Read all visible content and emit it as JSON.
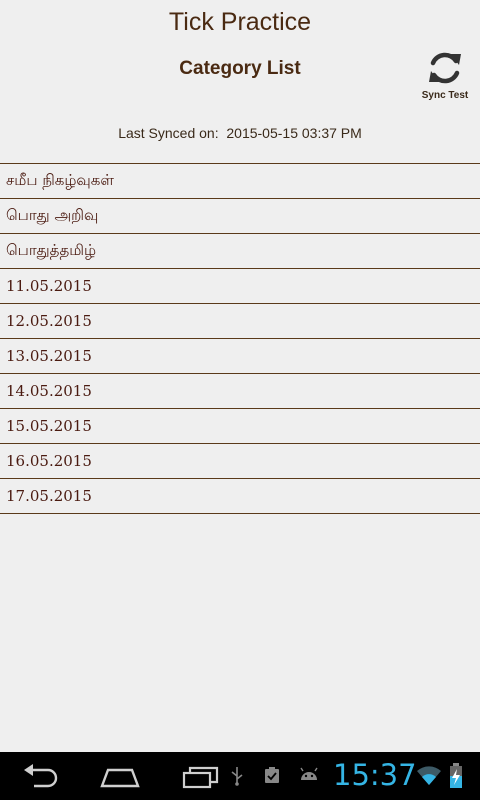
{
  "app": {
    "title": "Tick Practice"
  },
  "header": {
    "category_title": "Category List",
    "sync_button_label": "Sync Test",
    "sync_icon": "refresh-icon"
  },
  "sync_status": {
    "text": "Last Synced on:  2015-05-15 03:37 PM"
  },
  "categories": [
    {
      "label": "சமீப  நிகழ்வுகள்"
    },
    {
      "label": "பொது  அறிவு"
    },
    {
      "label": "பொதுத்தமிழ்"
    },
    {
      "label": "11.05.2015"
    },
    {
      "label": "12.05.2015"
    },
    {
      "label": "13.05.2015"
    },
    {
      "label": "14.05.2015"
    },
    {
      "label": "15.05.2015"
    },
    {
      "label": "16.05.2015"
    },
    {
      "label": "17.05.2015"
    }
  ],
  "system_bar": {
    "clock": "15:37",
    "icons": [
      "back-icon",
      "home-icon",
      "recent-apps-icon",
      "usb-icon",
      "clipboard-check-icon",
      "android-debug-icon",
      "wifi-icon",
      "battery-charging-icon"
    ]
  },
  "colors": {
    "background": "#efefef",
    "text": "#4a2a12",
    "divider": "#5a3a1a",
    "clock": "#35b5e5"
  }
}
